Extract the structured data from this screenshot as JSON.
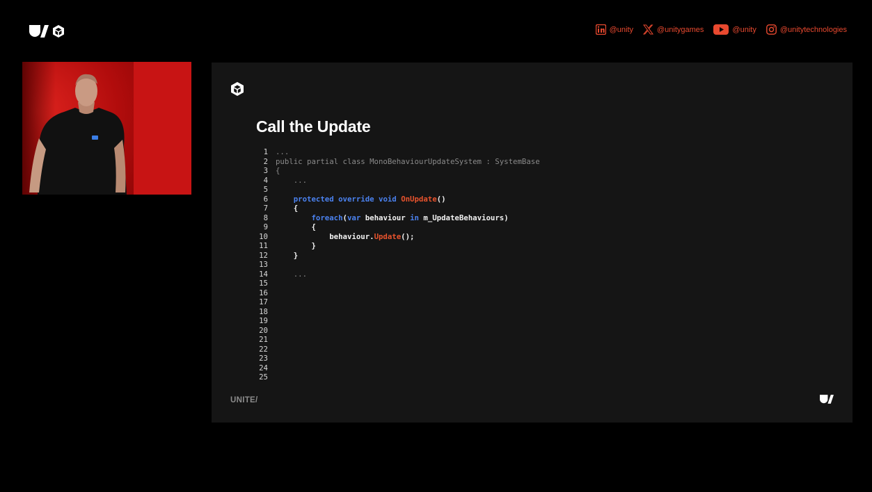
{
  "social": [
    {
      "icon": "linkedin-icon",
      "handle": "@unity"
    },
    {
      "icon": "x-icon",
      "handle": "@unitygames"
    },
    {
      "icon": "youtube-icon",
      "handle": "@unity"
    },
    {
      "icon": "instagram-icon",
      "handle": "@unitytechnologies"
    }
  ],
  "slide": {
    "title": "Call the Update",
    "footer_left": "UNITE/",
    "code_lines": [
      {
        "n": "1",
        "parts": [
          {
            "t": "...",
            "c": "dim"
          }
        ]
      },
      {
        "n": "2",
        "parts": [
          {
            "t": "public partial class MonoBehaviourUpdateSystem : SystemBase",
            "c": "dim"
          }
        ]
      },
      {
        "n": "3",
        "parts": [
          {
            "t": "{",
            "c": "dim"
          }
        ]
      },
      {
        "n": "4",
        "parts": [
          {
            "t": "    ...",
            "c": "dim"
          }
        ]
      },
      {
        "n": "5",
        "parts": []
      },
      {
        "n": "6",
        "parts": [
          {
            "t": "    ",
            "c": "txt"
          },
          {
            "t": "protected override void ",
            "c": "kw"
          },
          {
            "t": "OnUpdate",
            "c": "fn"
          },
          {
            "t": "()",
            "c": "txt"
          }
        ]
      },
      {
        "n": "7",
        "parts": [
          {
            "t": "    {",
            "c": "txt"
          }
        ]
      },
      {
        "n": "8",
        "parts": [
          {
            "t": "        ",
            "c": "txt"
          },
          {
            "t": "foreach",
            "c": "kw"
          },
          {
            "t": "(",
            "c": "txt"
          },
          {
            "t": "var",
            "c": "kw"
          },
          {
            "t": " behaviour ",
            "c": "txt"
          },
          {
            "t": "in",
            "c": "kw"
          },
          {
            "t": " m_UpdateBehaviours)",
            "c": "txt"
          }
        ]
      },
      {
        "n": "9",
        "parts": [
          {
            "t": "        {",
            "c": "txt"
          }
        ]
      },
      {
        "n": "10",
        "parts": [
          {
            "t": "            behaviour.",
            "c": "txt"
          },
          {
            "t": "Update",
            "c": "fn"
          },
          {
            "t": "();",
            "c": "txt"
          }
        ]
      },
      {
        "n": "11",
        "parts": [
          {
            "t": "        }",
            "c": "txt"
          }
        ]
      },
      {
        "n": "12",
        "parts": [
          {
            "t": "    }",
            "c": "txt"
          }
        ]
      },
      {
        "n": "13",
        "parts": []
      },
      {
        "n": "14",
        "parts": [
          {
            "t": "    ...",
            "c": "dim"
          }
        ]
      },
      {
        "n": "15",
        "parts": []
      },
      {
        "n": "16",
        "parts": []
      },
      {
        "n": "17",
        "parts": []
      },
      {
        "n": "18",
        "parts": []
      },
      {
        "n": "19",
        "parts": []
      },
      {
        "n": "20",
        "parts": []
      },
      {
        "n": "21",
        "parts": []
      },
      {
        "n": "22",
        "parts": []
      },
      {
        "n": "23",
        "parts": []
      },
      {
        "n": "24",
        "parts": []
      },
      {
        "n": "25",
        "parts": []
      }
    ]
  },
  "colors": {
    "background": "#000000",
    "slide_bg": "#151515",
    "accent": "#e8492f",
    "keyword": "#4b82f0",
    "function": "#e8532d"
  }
}
